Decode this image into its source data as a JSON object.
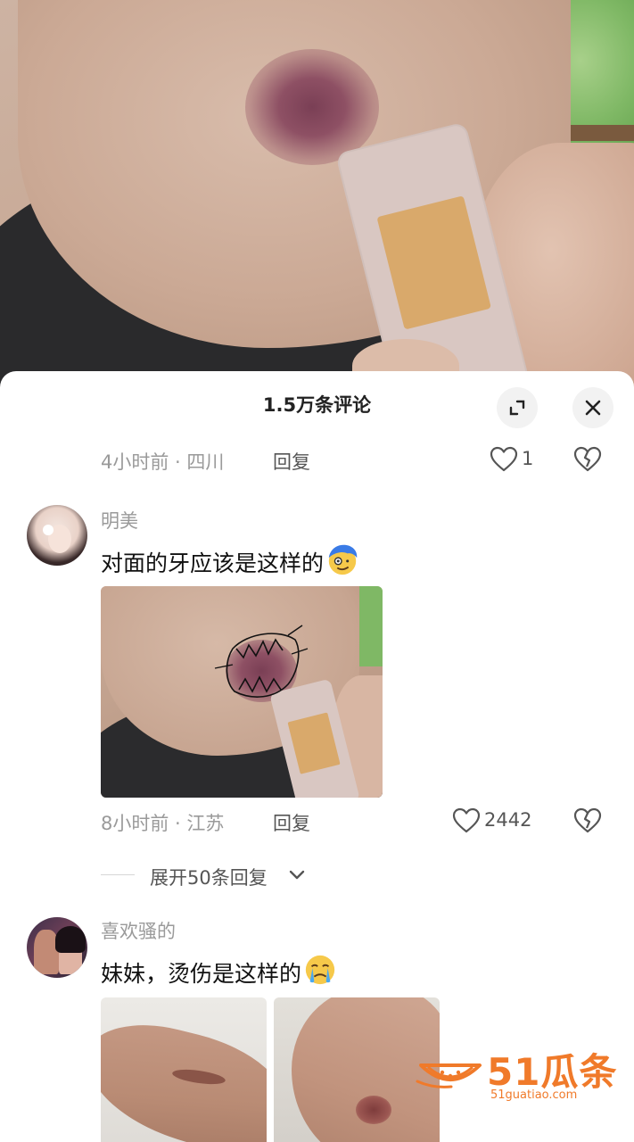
{
  "sheet": {
    "title": "1.5万条评论"
  },
  "comments": [
    {
      "time_location": "4小时前 · 四川",
      "reply_label": "回复",
      "likes": "1"
    },
    {
      "username": "明美",
      "text": "对面的牙应该是这样的",
      "emoji": "dizzy-face-emoji",
      "time_location": "8小时前 · 江苏",
      "reply_label": "回复",
      "likes": "2442",
      "expand_label": "展开50条回复"
    },
    {
      "username": "喜欢骚的",
      "text": "妹妹，烫伤是这样的",
      "emoji": "crying-face-emoji"
    }
  ],
  "icons": {
    "expand": "expand-icon",
    "close": "close-icon",
    "like": "heart-icon",
    "dislike": "broken-heart-icon",
    "chevron": "chevron-down-icon"
  },
  "watermark": {
    "brand": "51瓜条",
    "domain": "51guatiao.com"
  },
  "colors": {
    "watermark": "#f07a2a",
    "muted_text": "#9a9a9a",
    "body_text": "#111111"
  }
}
